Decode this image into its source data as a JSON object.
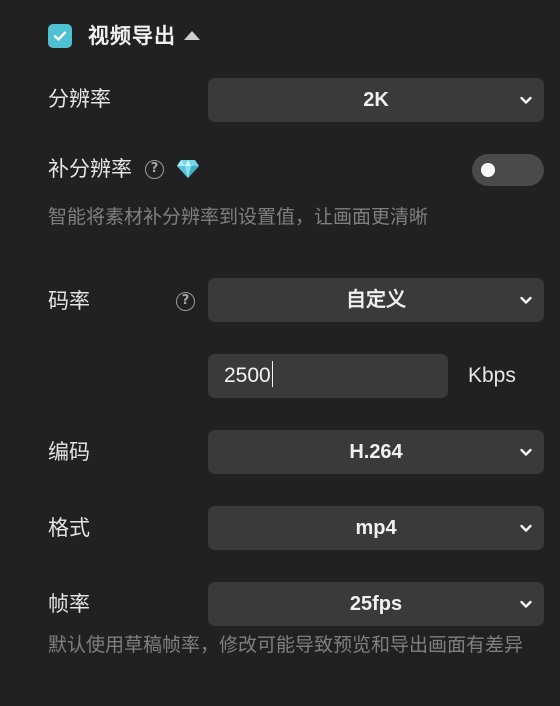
{
  "header": {
    "checked": true,
    "title": "视频导出"
  },
  "resolution": {
    "label": "分辨率",
    "value": "2K"
  },
  "super_resolution": {
    "label": "补分辨率",
    "toggle_on": false,
    "hint": "智能将素材补分辨率到设置值，让画面更清晰"
  },
  "bitrate": {
    "label": "码率",
    "value": "自定义",
    "custom_value": "2500",
    "unit": "Kbps"
  },
  "codec": {
    "label": "编码",
    "value": "H.264"
  },
  "format": {
    "label": "格式",
    "value": "mp4"
  },
  "frame_rate": {
    "label": "帧率",
    "value": "25fps",
    "hint": "默认使用草稿帧率，修改可能导致预览和导出画面有差异"
  },
  "colors": {
    "accent": "#4fc1d3",
    "gem": "#6fd6ec",
    "background": "#212121",
    "control": "#3a3a3a"
  }
}
